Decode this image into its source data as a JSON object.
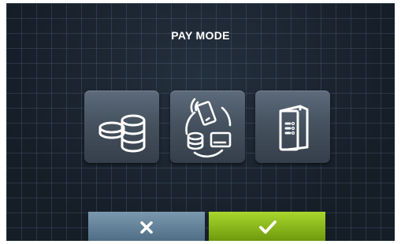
{
  "header": {
    "title": "PAY MODE"
  },
  "options": [
    {
      "icon": "coins-icon"
    },
    {
      "icon": "cashless-payment-icon"
    },
    {
      "icon": "central-payment-terminal-icon"
    }
  ],
  "actions": {
    "cancel": {
      "icon": "close-icon"
    },
    "confirm": {
      "icon": "check-icon"
    }
  },
  "colors": {
    "background": "#17212c",
    "tile": "#46525f",
    "cancel_button": "#5f7f96",
    "confirm_button": "#8cbf14",
    "icon": "#ffffff"
  }
}
